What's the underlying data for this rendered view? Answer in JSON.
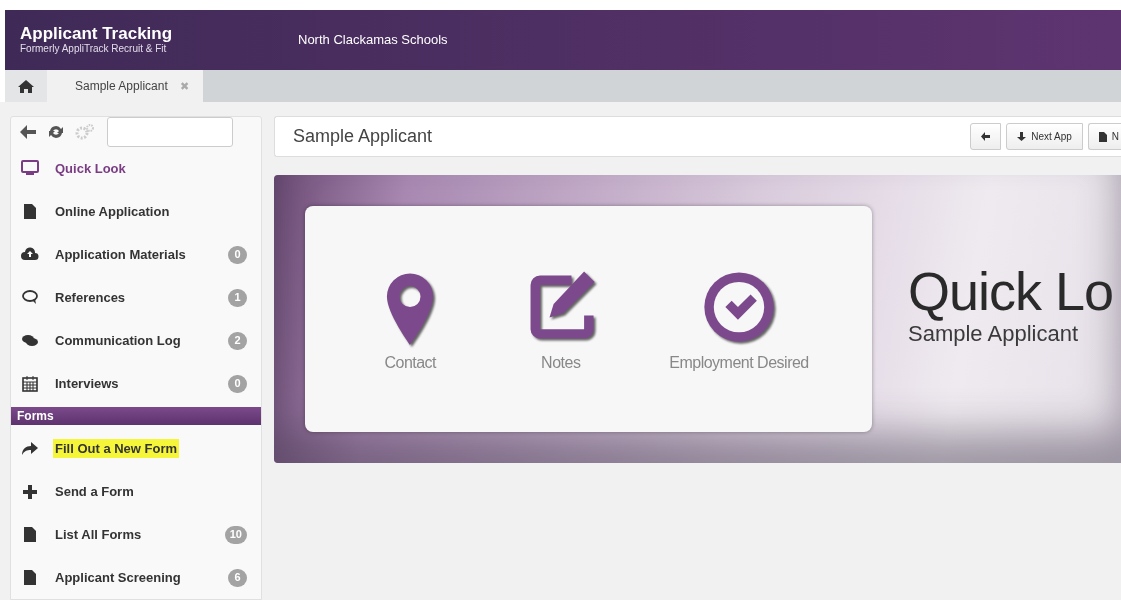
{
  "header": {
    "app_title": "Applicant Tracking",
    "app_subtitle": "Formerly AppliTrack Recruit & Fit",
    "district": "North Clackamas Schools"
  },
  "tabs": [
    {
      "kind": "home",
      "selected": false
    },
    {
      "kind": "page",
      "label": "Sample Applicant",
      "close": "✖",
      "selected": true
    }
  ],
  "sidebar": {
    "items": [
      {
        "label": "Quick Look",
        "selected": true,
        "highlighted": false
      },
      {
        "label": "Online Application",
        "selected": false,
        "highlighted": false
      },
      {
        "label": "Application Materials",
        "badge": "0",
        "selected": false,
        "highlighted": false
      },
      {
        "label": "References",
        "badge": "1",
        "selected": false,
        "highlighted": false
      },
      {
        "label": "Communication Log",
        "badge": "2",
        "selected": false,
        "highlighted": false
      },
      {
        "label": "Interviews",
        "badge": "0",
        "selected": false,
        "highlighted": false
      }
    ],
    "section": "Forms",
    "form_items": [
      {
        "label": "Fill Out a New Form",
        "selected": false,
        "highlighted": true
      },
      {
        "label": "Send a Form",
        "selected": false,
        "highlighted": false
      },
      {
        "label": "List All Forms",
        "badge": "10",
        "selected": false,
        "highlighted": false
      },
      {
        "label": "Applicant Screening",
        "badge": "6",
        "selected": false,
        "highlighted": false
      }
    ]
  },
  "page_title": "Sample Applicant",
  "toolbar": [
    {
      "kind": "back"
    },
    {
      "kind": "next",
      "label": "Next App"
    },
    {
      "kind": "doc",
      "label": "N"
    }
  ],
  "hero": {
    "tiles": [
      {
        "label": "Contact"
      },
      {
        "label": "Notes"
      },
      {
        "label": "Employment Desired"
      }
    ],
    "title": "Quick Lo",
    "subtitle": "Sample Applicant"
  }
}
